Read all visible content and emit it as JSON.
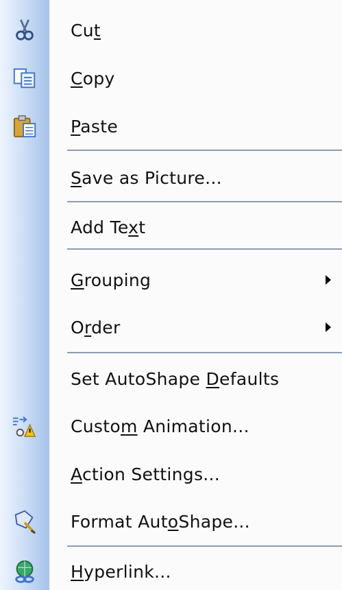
{
  "menu": {
    "items": [
      {
        "id": "cut",
        "pre": "Cu",
        "key": "t",
        "post": "",
        "icon": "scissors-icon"
      },
      {
        "id": "copy",
        "pre": "",
        "key": "C",
        "post": "opy",
        "icon": "copy-icon"
      },
      {
        "id": "paste",
        "pre": "",
        "key": "P",
        "post": "aste",
        "icon": "paste-icon"
      },
      {
        "id": "save-as-picture",
        "pre": "",
        "key": "S",
        "post": "ave as Picture..."
      },
      {
        "id": "add-text",
        "pre": "Add Te",
        "key": "x",
        "post": "t"
      },
      {
        "id": "grouping",
        "pre": "",
        "key": "G",
        "post": "rouping",
        "submenu": true
      },
      {
        "id": "order",
        "pre": "O",
        "key": "r",
        "post": "der",
        "submenu": true
      },
      {
        "id": "set-autoshape-defaults",
        "pre": "Set AutoShape ",
        "key": "D",
        "post": "efaults"
      },
      {
        "id": "custom-animation",
        "pre": "Custo",
        "key": "m",
        "post": " Animation...",
        "icon": "custom-animation-icon"
      },
      {
        "id": "action-settings",
        "pre": "",
        "key": "A",
        "post": "ction Settings..."
      },
      {
        "id": "format-autoshape",
        "pre": "Format Aut",
        "key": "o",
        "post": "Shape...",
        "icon": "format-autoshape-icon"
      },
      {
        "id": "hyperlink",
        "pre": "",
        "key": "H",
        "post": "yperlink...",
        "icon": "hyperlink-icon"
      }
    ]
  },
  "colors": {
    "gutter_light": "#eef4fd",
    "gutter_dark": "#a6c2ea",
    "separator": "#8c9bb0"
  }
}
